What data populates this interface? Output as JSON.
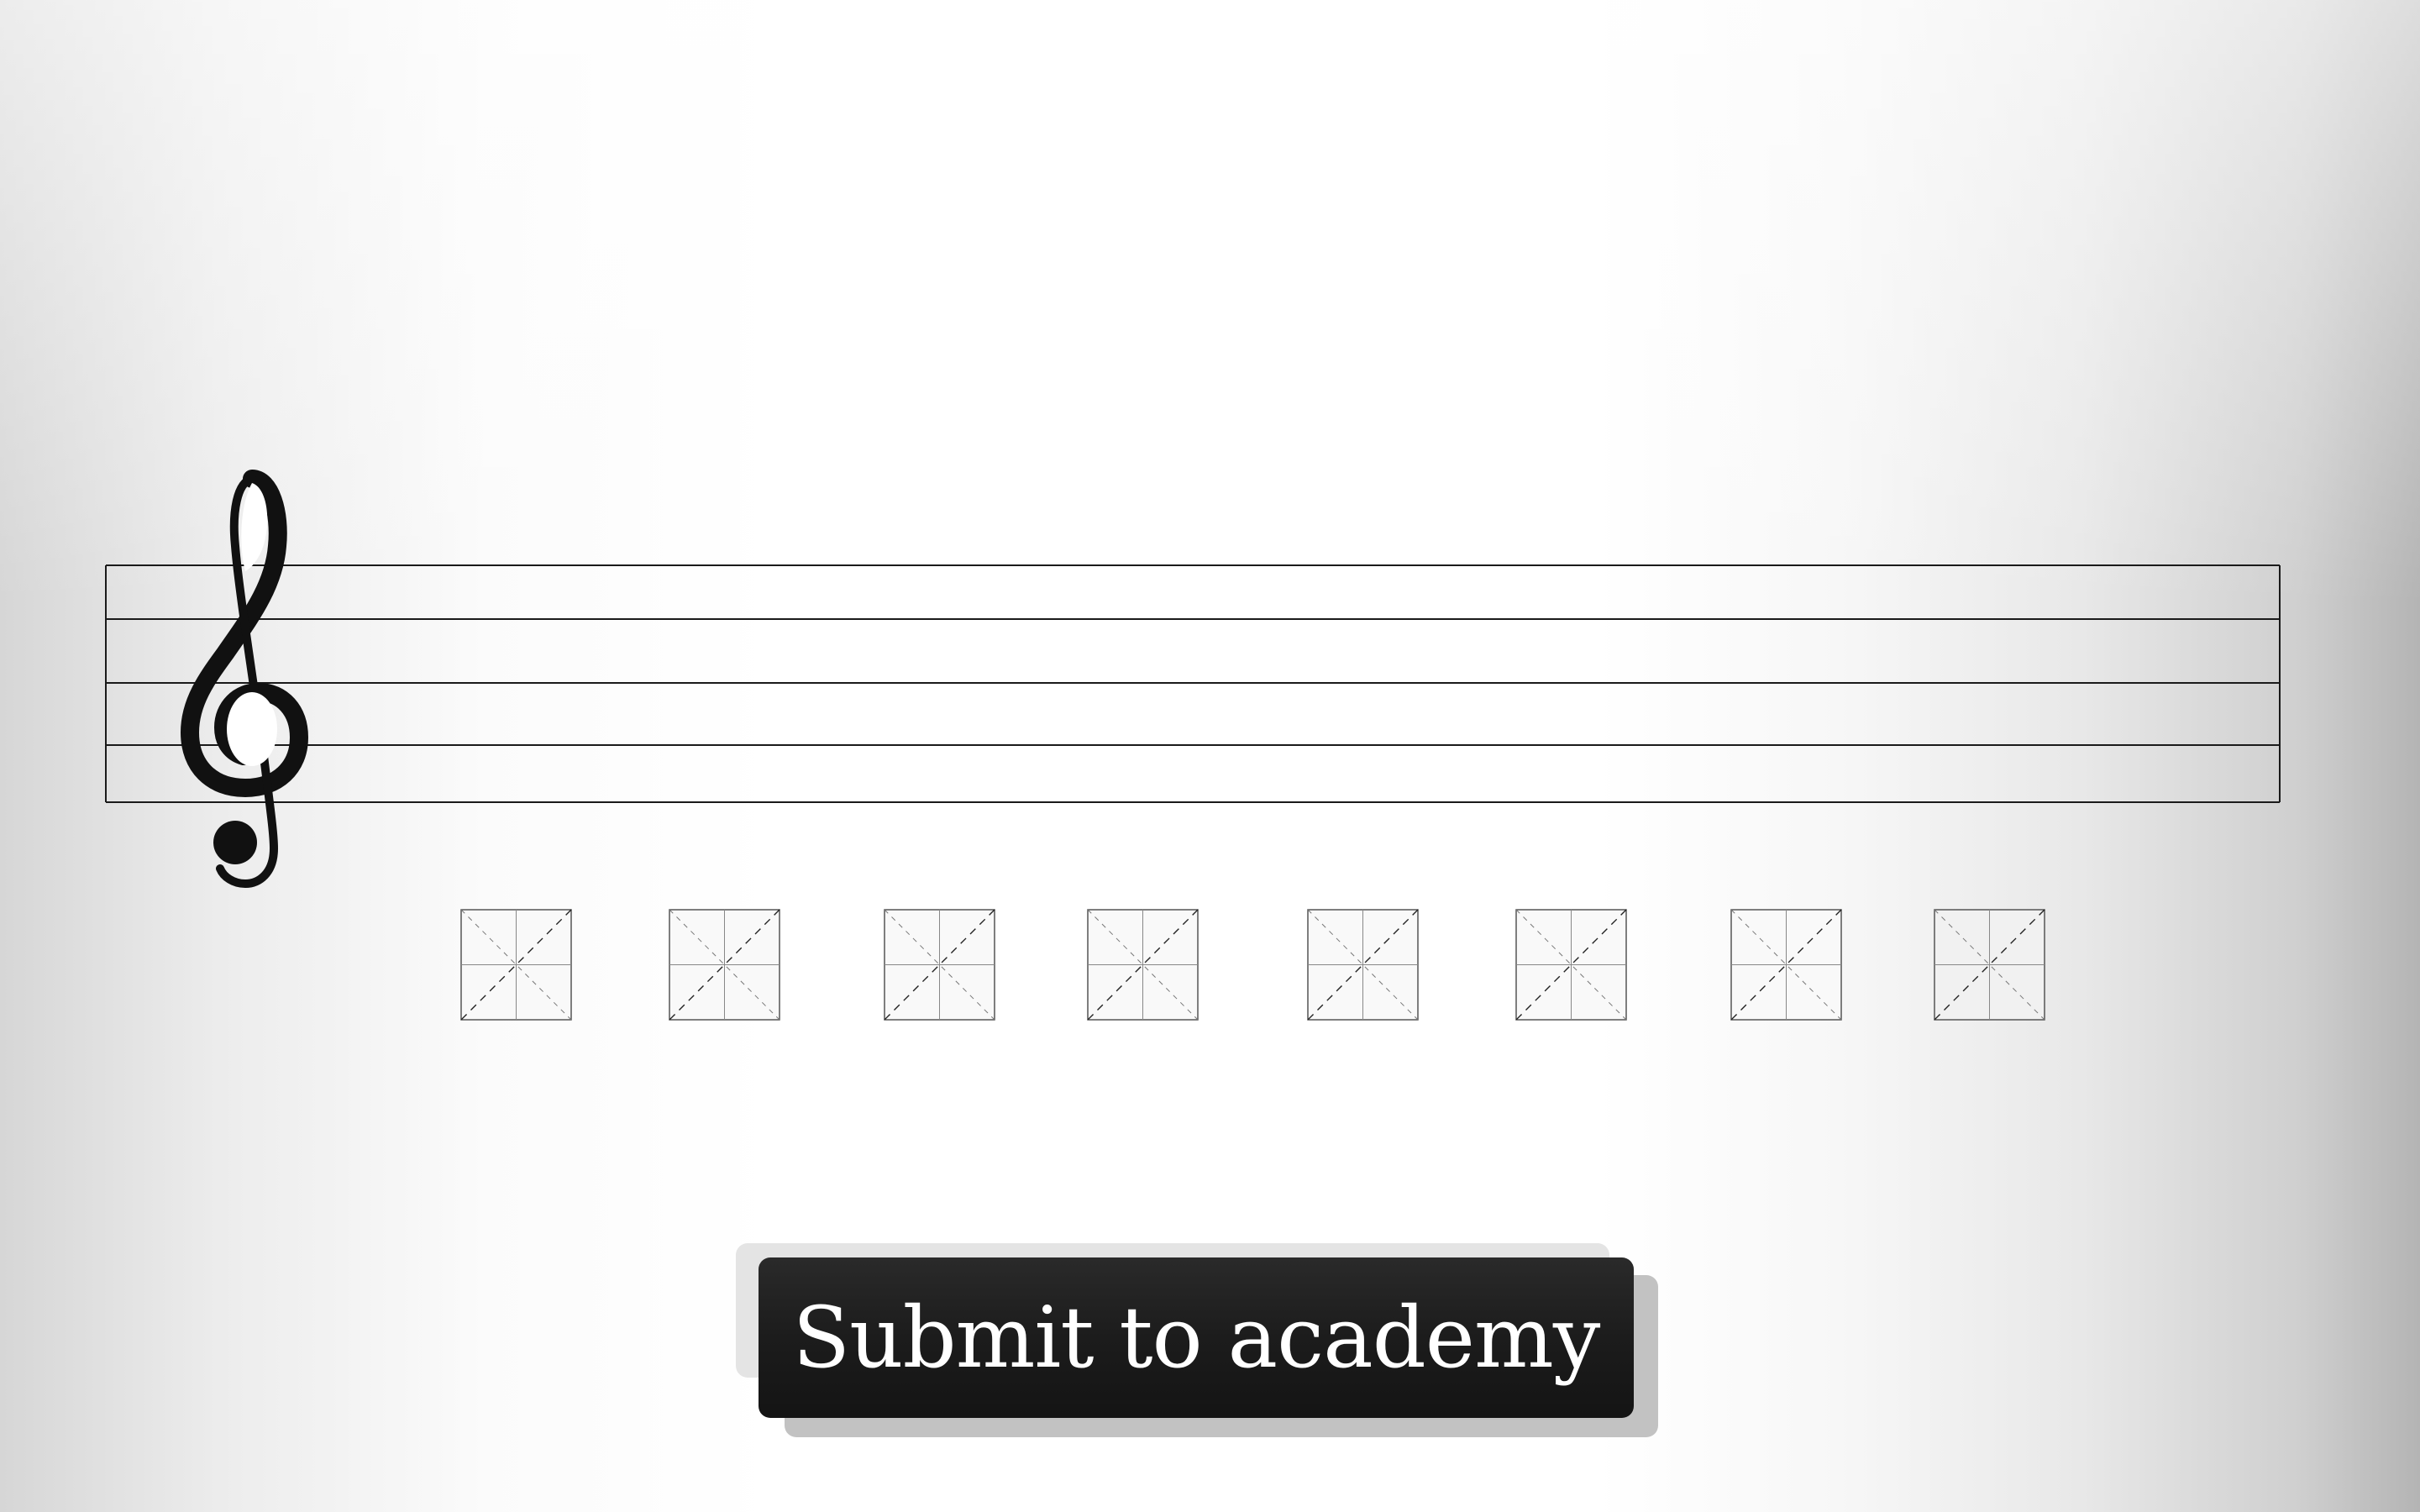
{
  "staff": {
    "clef": "treble-clef-icon",
    "line_color": "#1a1a1a",
    "line_count": 5
  },
  "answer_slots": [
    {
      "name": "answer-slot-1",
      "icon": "empty-slot-grid-icon"
    },
    {
      "name": "answer-slot-2",
      "icon": "empty-slot-grid-icon"
    },
    {
      "name": "answer-slot-3",
      "icon": "empty-slot-grid-icon"
    },
    {
      "name": "answer-slot-4",
      "icon": "empty-slot-grid-icon"
    },
    {
      "name": "answer-slot-5",
      "icon": "empty-slot-grid-icon"
    },
    {
      "name": "answer-slot-6",
      "icon": "empty-slot-grid-icon"
    },
    {
      "name": "answer-slot-7",
      "icon": "empty-slot-grid-icon"
    },
    {
      "name": "answer-slot-8",
      "icon": "empty-slot-grid-icon"
    }
  ],
  "submit": {
    "label": "Submit to academy",
    "background": "#1c1c1c",
    "text_color": "#ffffff"
  }
}
